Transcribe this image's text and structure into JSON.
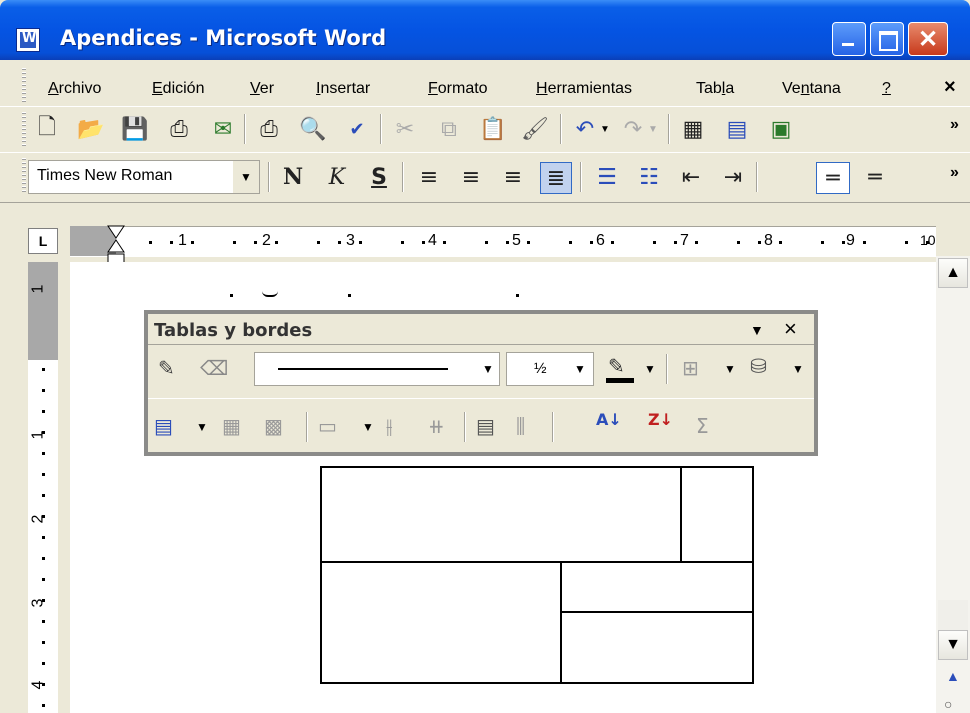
{
  "window": {
    "title": "Apendices - Microsoft Word"
  },
  "menu": {
    "items": [
      {
        "label": "Archivo",
        "hotkey": "A",
        "rest": "rchivo"
      },
      {
        "label": "Edición",
        "hotkey": "E",
        "rest": "dición"
      },
      {
        "label": "Ver",
        "hotkey": "V",
        "rest": "er"
      },
      {
        "label": "Insertar",
        "hotkey": "I",
        "rest": "nsertar"
      },
      {
        "label": "Formato",
        "hotkey": "F",
        "rest": "ormato"
      },
      {
        "label": "Herramientas",
        "hotkey": "H",
        "rest": "erramientas"
      },
      {
        "label": "Tabla",
        "pre": "Tab",
        "hotkey": "l",
        "rest": "a"
      },
      {
        "label": "Ventana",
        "pre": "Ve",
        "hotkey": "n",
        "rest": "tana"
      },
      {
        "label": "?",
        "hotkey": "?",
        "rest": ""
      }
    ],
    "close": "×"
  },
  "format_toolbar": {
    "font_name": "Times New Roman",
    "bold": "N",
    "italic": "K",
    "underline": "S"
  },
  "ruler": {
    "tab_selector": "L",
    "numbers": [
      "1",
      "2",
      "3",
      "4",
      "5",
      "6",
      "7",
      "8",
      "9",
      "10"
    ],
    "vertical_numbers": [
      "1",
      "1",
      "2",
      "3",
      "4"
    ]
  },
  "tables_toolbar": {
    "title": "Tablas y bordes",
    "line_weight": "½",
    "close": "×",
    "sum_symbol": "Σ"
  },
  "colors": {
    "title_bar": "#0554e3",
    "chrome": "#ece9d8",
    "document": "#ffffff"
  }
}
